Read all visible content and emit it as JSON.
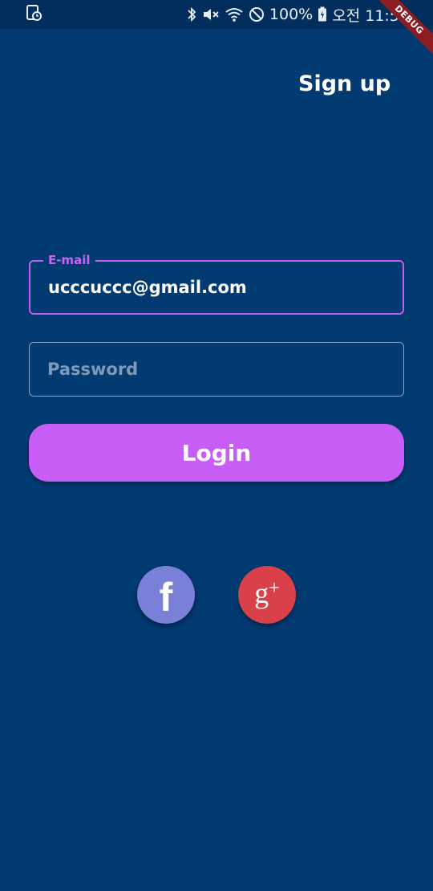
{
  "status_bar": {
    "battery": "100%",
    "time": "오전 11:54"
  },
  "debug_banner": "DEBUG",
  "header": {
    "signup_label": "Sign up"
  },
  "form": {
    "email": {
      "label": "E-mail",
      "value": "ucccuccc@gmail.com"
    },
    "password": {
      "placeholder": "Password"
    },
    "login_label": "Login"
  },
  "social": {
    "facebook_glyph": "f",
    "google_glyph": "g",
    "google_plus": "+",
    "facebook_color": "#7a7fd8",
    "google_color": "#d9414a"
  },
  "colors": {
    "background": "#023a72",
    "accent": "#c85df6"
  }
}
